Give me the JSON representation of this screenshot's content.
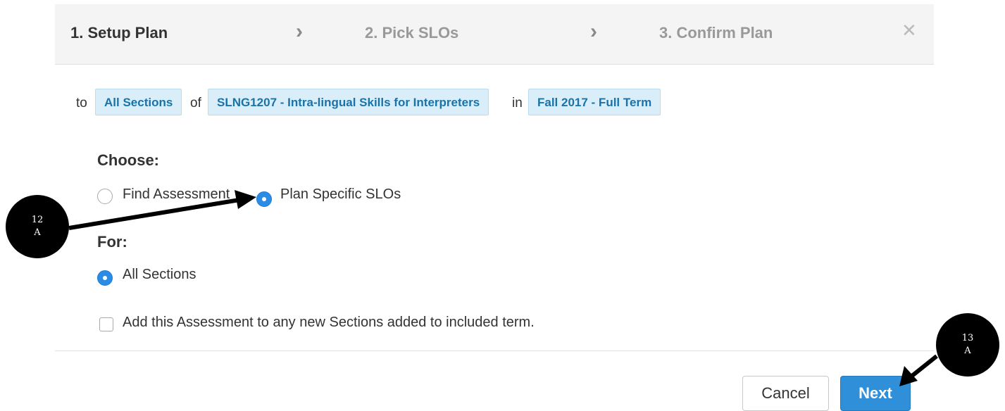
{
  "wizard": {
    "steps": [
      {
        "label": "1. Setup Plan"
      },
      {
        "label": "2. Pick SLOs"
      },
      {
        "label": "3. Confirm Plan"
      }
    ],
    "close_icon": "close-icon",
    "chevron_icon": "chevron-right-icon"
  },
  "context": {
    "to_text": "to",
    "sections_chip": "All Sections",
    "of_text": "of",
    "course_chip": "SLNG1207 - Intra-lingual Skills for Interpreters",
    "in_text": "in",
    "term_chip": "Fall 2017 - Full Term"
  },
  "choose": {
    "label": "Choose:",
    "options": [
      {
        "label": "Find Assessment",
        "selected": false
      },
      {
        "label": "Plan Specific SLOs",
        "selected": true
      }
    ]
  },
  "for_section": {
    "label": "For:",
    "options": [
      {
        "label": "All Sections",
        "selected": true
      }
    ]
  },
  "checkbox": {
    "label": "Add this Assessment to any new Sections added to included term.",
    "checked": false
  },
  "buttons": {
    "cancel": "Cancel",
    "next": "Next"
  },
  "annotations": [
    {
      "line1": "12",
      "line2": "A"
    },
    {
      "line1": "13",
      "line2": "A"
    }
  ],
  "colors": {
    "accent_blue": "#2f8fd8",
    "chip_bg": "#d9eef9",
    "chip_text": "#1a73a8",
    "header_bg": "#f4f4f4"
  }
}
